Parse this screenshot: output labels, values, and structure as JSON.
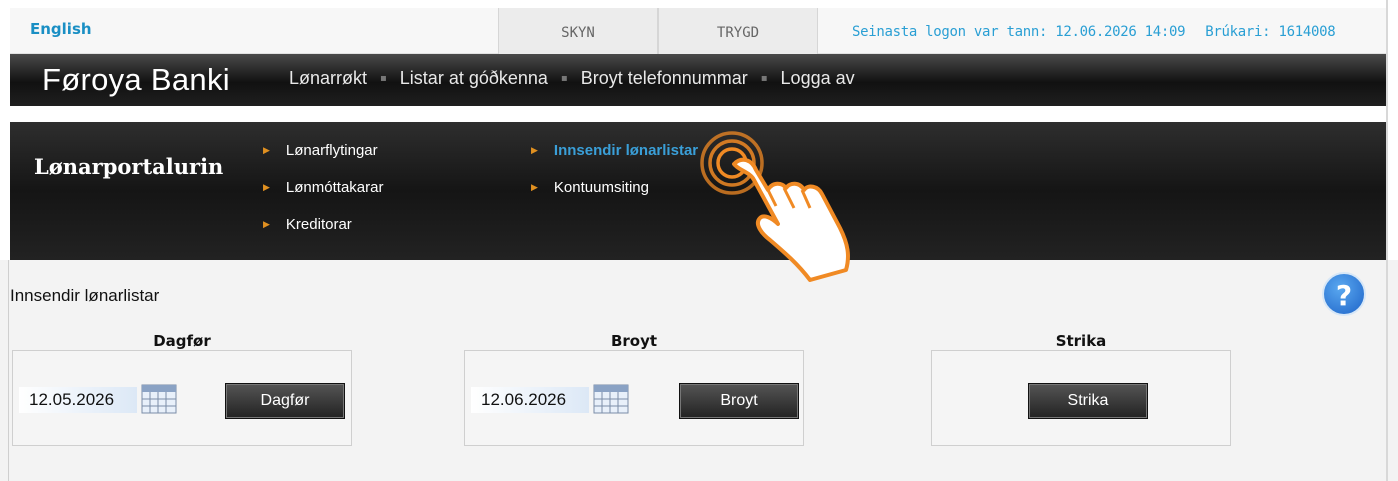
{
  "topbar": {
    "language_link": "English",
    "tabs": [
      "SKYN",
      "TRYGD"
    ],
    "last_logon": "Seinasta logon var tann: 12.06.2026 14:09",
    "user": "Brúkari: 1614008"
  },
  "mainnav": {
    "brand": "Føroya Banki",
    "links": [
      "Lønarrøkt",
      "Listar at góðkenna",
      "Broyt telefonnummar",
      "Logga av"
    ]
  },
  "portal": {
    "title": "Lønarportalurin",
    "links_col1": [
      "Lønarflytingar",
      "Lønmóttakarar",
      "Kreditorar"
    ],
    "links_col2": [
      "Innsendir lønarlistar",
      "Kontuumsiting"
    ],
    "active_link": "Innsendir lønarlistar"
  },
  "content": {
    "page_title": "Innsendir lønarlistar",
    "help_symbol": "?",
    "panels": {
      "dagfor": {
        "label": "Dagfør",
        "date": "12.05.2026",
        "button": "Dagfør"
      },
      "broyt": {
        "label": "Broyt",
        "date": "12.06.2026",
        "button": "Broyt"
      },
      "strika": {
        "label": "Strika",
        "button": "Strika"
      }
    }
  },
  "colors": {
    "link_blue": "#1a8fc4",
    "active_link": "#3a9fd8",
    "arrow_orange": "#e09020",
    "cursor_orange": "#f08a24",
    "nav_dark": "#151515"
  },
  "icons": [
    "calendar-icon",
    "hand-pointer-icon",
    "help-icon",
    "chevron-right-icon"
  ]
}
